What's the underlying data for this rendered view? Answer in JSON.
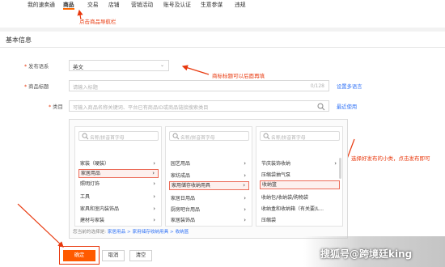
{
  "nav": {
    "items": [
      "我的速卖通",
      "商品",
      "交易",
      "店铺",
      "营销活动",
      "账号及认证",
      "生意参谋",
      "违规"
    ],
    "active": "商品"
  },
  "annotations": {
    "nav_hint": "点击商品导航栏",
    "title_hint": "商标标题可以后面再填",
    "category_hint": "选择好发布的小类，点击发布即可"
  },
  "section_title": "基本信息",
  "form": {
    "language": {
      "label": "发布语系",
      "value": "英文"
    },
    "title": {
      "label": "商品标题",
      "placeholder": "请输入标题",
      "counter": "0/128",
      "link": "设置多语言"
    },
    "category": {
      "label": "类目",
      "placeholder": "可输入商品名称关键词、平台已有商品ID或商品链接搜索类目",
      "link": "最近使用"
    }
  },
  "picker": {
    "search_placeholder": "名称/拼音首字母",
    "columns": [
      {
        "items": [
          {
            "label": "家装（硬装）",
            "arrow": true
          },
          {
            "label": "家居用品",
            "arrow": true,
            "selected": true
          },
          {
            "label": "照明灯饰",
            "arrow": true
          },
          {
            "label": "工具",
            "arrow": true
          },
          {
            "label": "家具和室内装饰品",
            "arrow": true
          },
          {
            "label": "建材与家装",
            "arrow": true
          }
        ]
      },
      {
        "items": [
          {
            "label": "园艺用品",
            "arrow": true
          },
          {
            "label": "家纺成品",
            "arrow": true
          },
          {
            "label": "家用储存收纳用具",
            "arrow": true,
            "selected": true
          },
          {
            "label": "家居日用品",
            "arrow": true
          },
          {
            "label": "厨房吧台用品",
            "arrow": true
          },
          {
            "label": "家居装饰品",
            "arrow": true
          }
        ]
      },
      {
        "items": [
          {
            "label": "节庆装饰收纳",
            "arrow": true
          },
          {
            "label": "压缩袋抽气泵",
            "arrow": false
          },
          {
            "label": "收纳篮",
            "arrow": false,
            "selected": true
          },
          {
            "label": "收纳包/收纳袋/购物袋",
            "arrow": false
          },
          {
            "label": "收纳盒和收纳箱（有关要/L...",
            "arrow": false
          },
          {
            "label": "压缩袋",
            "arrow": false
          }
        ]
      }
    ],
    "selected_label": "您当前的选择是:",
    "selected_path": "家居用品 > 家用储存收纳用具 > 收纳篮"
  },
  "buttons": {
    "publish": "确定",
    "cancel": "取消",
    "clear": "清空"
  },
  "watermark": "搜狐号@跨境廷king",
  "colors": {
    "accent": "#ff5a00",
    "annotation": "#e8380d",
    "link": "#3072f6"
  }
}
